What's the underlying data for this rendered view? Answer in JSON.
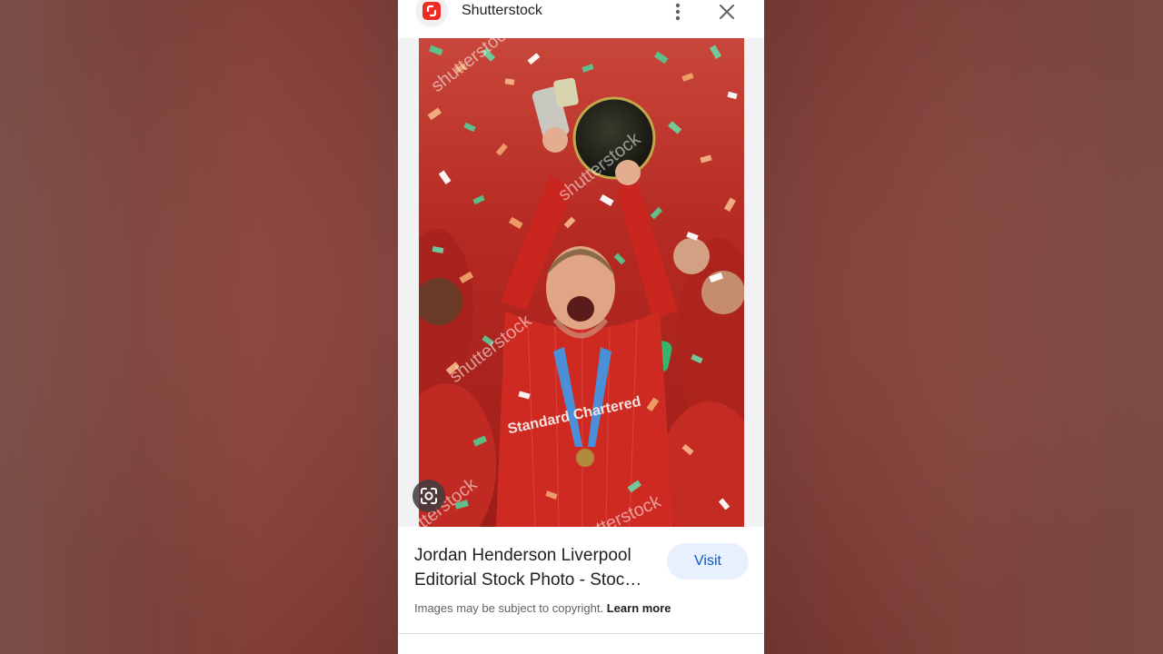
{
  "header": {
    "site_name": "Shutterstock",
    "favicon_icon": "shutterstock-logo-icon",
    "more_icon": "more-vert-icon",
    "close_icon": "close-icon"
  },
  "image": {
    "watermark_text": "shutterstock",
    "jersey_text": "Standard Chartered",
    "lens_icon": "google-lens-icon"
  },
  "result": {
    "title_line1": "Jordan Henderson Liverpool",
    "title_line2": "Editorial Stock Photo - Stoc…",
    "visit_label": "Visit",
    "copyright_text": "Images may be subject to copyright.",
    "learn_more_label": "Learn more"
  },
  "colors": {
    "brand": "#ee2b24",
    "visit_bg": "#e8f0fe",
    "visit_text": "#0b57d0"
  }
}
